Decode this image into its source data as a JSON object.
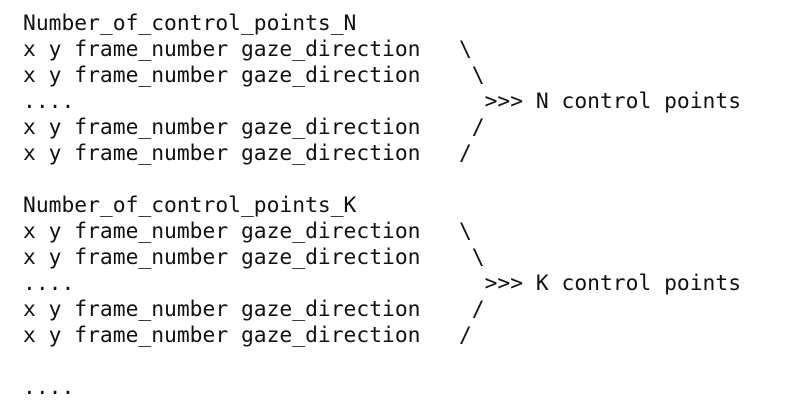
{
  "blocks": [
    {
      "header": "Number_of_control_points_N",
      "lines": [
        "x y frame_number gaze_direction   \\",
        "x y frame_number gaze_direction    \\",
        "....                                >>> N control points",
        "x y frame_number gaze_direction    /",
        "x y frame_number gaze_direction   /"
      ]
    },
    {
      "header": "Number_of_control_points_K",
      "lines": [
        "x y frame_number gaze_direction   \\",
        "x y frame_number gaze_direction    \\",
        "....                                >>> K control points",
        "x y frame_number gaze_direction    /",
        "x y frame_number gaze_direction   /"
      ]
    }
  ],
  "footer": "...."
}
